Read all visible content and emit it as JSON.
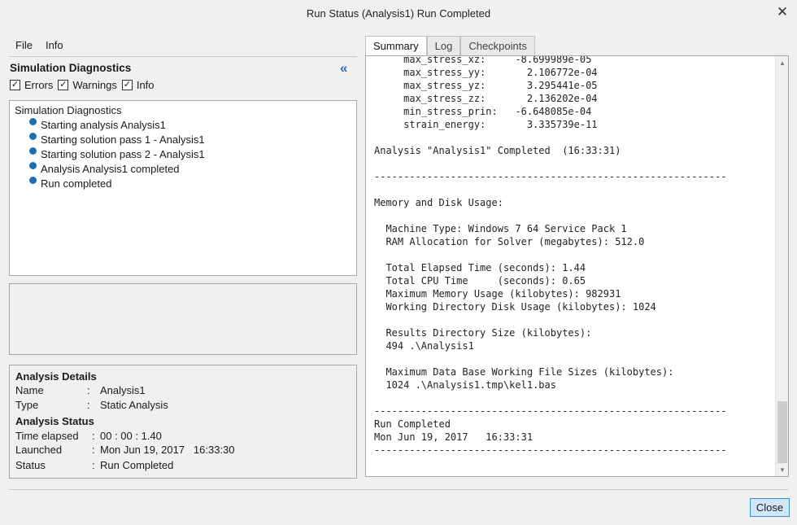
{
  "window": {
    "title": "Run Status (Analysis1) Run Completed",
    "close_glyph": "✕"
  },
  "menu": {
    "items": [
      "File",
      "Info"
    ]
  },
  "diagnostics": {
    "title": "Simulation Diagnostics",
    "collapse_glyph": "«",
    "filters": [
      {
        "label": "Errors",
        "checked": true
      },
      {
        "label": "Warnings",
        "checked": true
      },
      {
        "label": "Info",
        "checked": true
      }
    ],
    "tree_root": "Simulation Diagnostics",
    "tree_items": [
      "Starting analysis Analysis1",
      "Starting solution pass 1 - Analysis1",
      "Starting solution pass 2 - Analysis1",
      "Analysis Analysis1 completed",
      "Run completed"
    ]
  },
  "details": {
    "analysis_details_title": "Analysis Details",
    "name_label": "Name",
    "name_value": "Analysis1",
    "type_label": "Type",
    "type_value": "Static Analysis",
    "analysis_status_title": "Analysis Status",
    "time_label": "Time elapsed",
    "time_value": "00 : 00 : 1.40",
    "launched_label": "Launched",
    "launched_value": "Mon Jun 19, 2017   16:33:30",
    "status_label": "Status",
    "status_value": "Run Completed",
    "separator": ":"
  },
  "tabs": [
    "Summary",
    "Log",
    "Checkpoints"
  ],
  "summary_log": "     max_stress_xz:     -8.699989e-05\n     max_stress_yy:       2.106772e-04\n     max_stress_yz:       3.295441e-05\n     max_stress_zz:       2.136202e-04\n     min_stress_prin:   -6.648085e-04\n     strain_energy:       3.335739e-11\n\nAnalysis \"Analysis1\" Completed  (16:33:31)\n\n------------------------------------------------------------\n\nMemory and Disk Usage:\n\n  Machine Type: Windows 7 64 Service Pack 1\n  RAM Allocation for Solver (megabytes): 512.0\n\n  Total Elapsed Time (seconds): 1.44\n  Total CPU Time     (seconds): 0.65\n  Maximum Memory Usage (kilobytes): 982931\n  Working Directory Disk Usage (kilobytes): 1024\n\n  Results Directory Size (kilobytes):\n  494 .\\Analysis1\n\n  Maximum Data Base Working File Sizes (kilobytes):\n  1024 .\\Analysis1.tmp\\kel1.bas\n\n------------------------------------------------------------\nRun Completed\nMon Jun 19, 2017   16:33:31\n------------------------------------------------------------",
  "buttons": {
    "close": "Close"
  },
  "icons": {
    "check": "✓",
    "scroll_up": "▲",
    "scroll_down": "▼",
    "bullet_color": "#1f6fb0"
  }
}
